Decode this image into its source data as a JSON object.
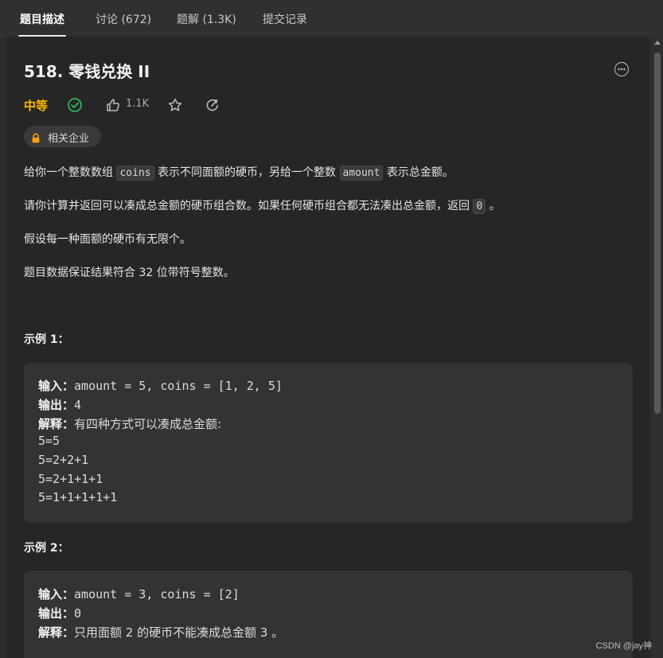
{
  "tabs": [
    {
      "label": "题目描述"
    },
    {
      "label": "讨论 (672)"
    },
    {
      "label": "题解 (1.3K)"
    },
    {
      "label": "提交记录"
    }
  ],
  "problem": {
    "title": "518. 零钱兑换 II",
    "difficulty": "中等",
    "difficulty_color": "#ffb800",
    "solved_color": "#2db55d",
    "likes": "1.1K",
    "company_tag": "相关企业",
    "lock_color": "#ffa116"
  },
  "description": {
    "p1": {
      "a": "给你一个整数数组 ",
      "code1": "coins",
      "b": " 表示不同面额的硬币，另给一个整数 ",
      "code2": "amount",
      "c": " 表示总金额。"
    },
    "p2": {
      "a": "请你计算并返回可以凑成总金额的硬币组合数。如果任何硬币组合都无法凑出总金额，返回 ",
      "code": "0",
      "b": " 。"
    },
    "p3": "假设每一种面额的硬币有无限个。",
    "p4": "题目数据保证结果符合 32 位带符号整数。"
  },
  "examples": [
    {
      "title": "示例 1：",
      "input_label": "输入：",
      "input": "amount = 5, coins = [1, 2, 5]",
      "output_label": "输出：",
      "output": "4",
      "explain_label": "解释：",
      "explain": "有四种方式可以凑成总金额:",
      "lines": [
        "5=5",
        "5=2+2+1",
        "5=2+1+1+1",
        "5=1+1+1+1+1"
      ]
    },
    {
      "title": "示例 2：",
      "input_label": "输入：",
      "input": "amount = 3, coins = [2]",
      "output_label": "输出：",
      "output": "0",
      "explain_label": "解释：",
      "explain": "只用面额 2 的硬币不能凑成总金额 3 。"
    }
  ],
  "watermark": "CSDN @jay神"
}
